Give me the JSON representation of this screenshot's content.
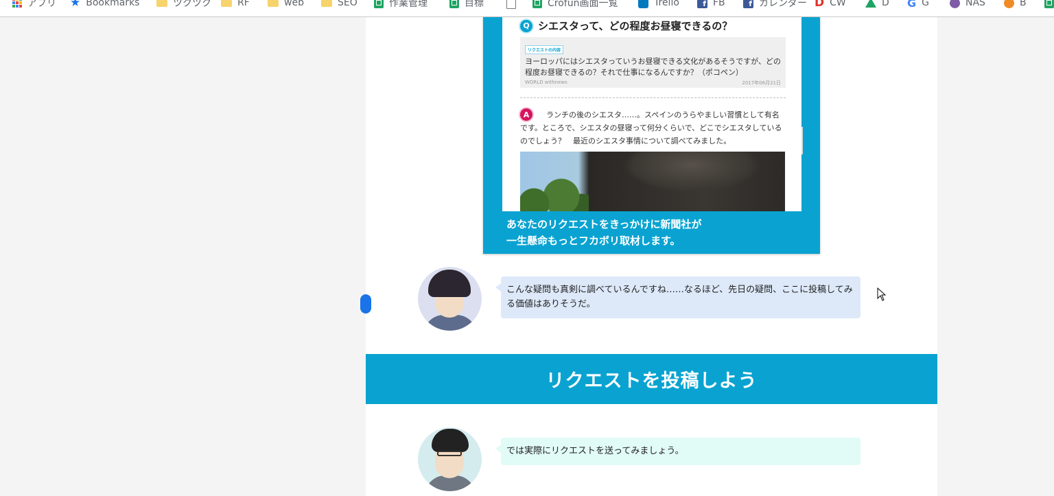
{
  "bookmarks": {
    "items": [
      {
        "label": "アプリ",
        "icon": "apps-grid-icon"
      },
      {
        "label": "Bookmarks",
        "icon": "star-icon"
      },
      {
        "label": "ツクツク",
        "icon": "folder-icon"
      },
      {
        "label": "RF",
        "icon": "folder-icon"
      },
      {
        "label": "web",
        "icon": "folder-icon"
      },
      {
        "label": "SEO",
        "icon": "folder-icon"
      },
      {
        "label": "作業管理",
        "icon": "sheets-icon"
      },
      {
        "label": "目標",
        "icon": "sheets-icon"
      },
      {
        "label": "",
        "icon": "document-icon"
      },
      {
        "label": "Crofun画面一覧",
        "icon": "sheets-icon"
      },
      {
        "label": "Trello",
        "icon": "trello-icon"
      },
      {
        "label": "FB",
        "icon": "facebook-icon"
      },
      {
        "label": "カレンダー",
        "icon": "facebook-icon"
      },
      {
        "label": "CW",
        "icon": "d-logo-icon"
      },
      {
        "label": "D",
        "icon": "drive-icon"
      },
      {
        "label": "G",
        "icon": "google-icon"
      },
      {
        "label": "NAS",
        "icon": "nas-icon"
      },
      {
        "label": "B",
        "icon": "b-icon"
      }
    ]
  },
  "embedded": {
    "question": {
      "badge": "Q",
      "title": "シエスタって、どの程度お昼寝できるの？",
      "request_label": "リクエストの内容",
      "request_text": "ヨーロッパにはシエスタっていうお昼寝できる文化があるそうですが、どの程度お昼寝できるの？それで仕事になるんですか？（ポコペン）",
      "category": "WORLD withnews",
      "date": "2017年06月21日"
    },
    "answer": {
      "badge": "A",
      "text": "ランチの後のシエスタ……。スペインのうらやましい習慣として有名です。ところで、シエスタの昼寝って何分くらいで、どこでシエスタしているのでしょう？　最近のシエスタ事情について調べてみました。"
    },
    "caption_line1": "あなたのリクエストをきっかけに新聞社が",
    "caption_line2": "一生懸命もっとフカボリ取材します。"
  },
  "chat": {
    "bubble1": "こんな疑問も真剣に調べているんですね……なるほど、先日の疑問、ここに投稿してみる価値はありそうだ。",
    "bubble2": "では実際にリクエストを送ってみましょう。"
  },
  "section": {
    "title": "リクエストを投稿しよう"
  },
  "colors": {
    "accent": "#0aa3d1",
    "answer_badge": "#d6145d",
    "bubble1_bg": "#dde9f9",
    "bubble2_bg": "#e1fbf6"
  }
}
